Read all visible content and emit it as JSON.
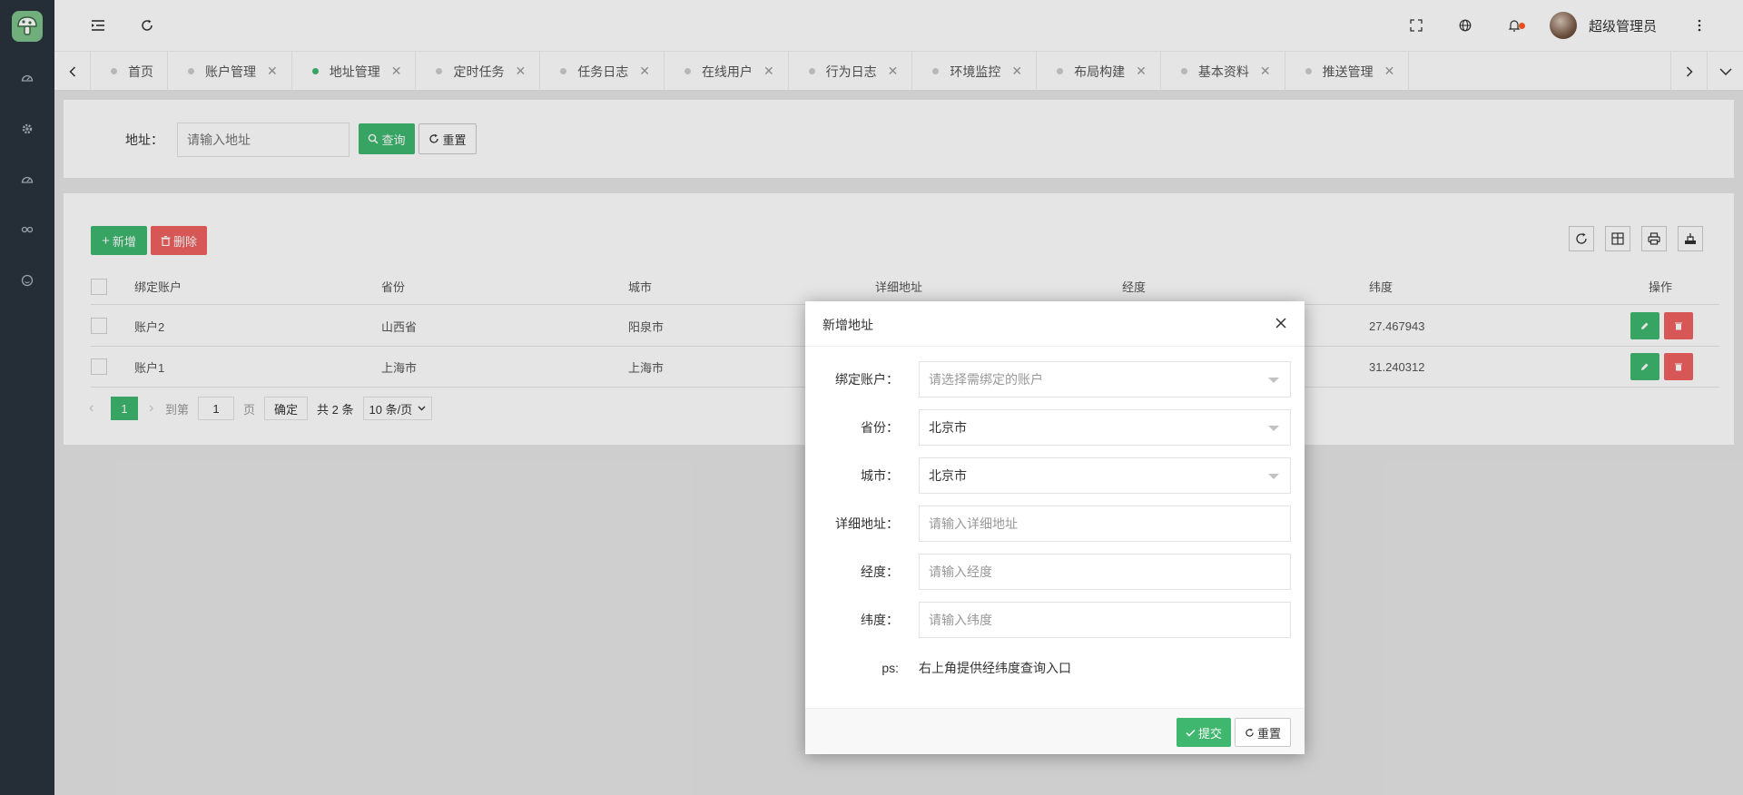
{
  "topbar": {
    "username": "超级管理员"
  },
  "tabs": [
    {
      "label": "首页",
      "closable": false,
      "active": false
    },
    {
      "label": "账户管理",
      "closable": true,
      "active": false
    },
    {
      "label": "地址管理",
      "closable": true,
      "active": true
    },
    {
      "label": "定时任务",
      "closable": true,
      "active": false
    },
    {
      "label": "任务日志",
      "closable": true,
      "active": false
    },
    {
      "label": "在线用户",
      "closable": true,
      "active": false
    },
    {
      "label": "行为日志",
      "closable": true,
      "active": false
    },
    {
      "label": "环境监控",
      "closable": true,
      "active": false
    },
    {
      "label": "布局构建",
      "closable": true,
      "active": false
    },
    {
      "label": "基本资料",
      "closable": true,
      "active": false
    },
    {
      "label": "推送管理",
      "closable": true,
      "active": false
    }
  ],
  "search": {
    "label": "地址：",
    "placeholder": "请输入地址",
    "query_btn": "查询",
    "reset_btn": "重置"
  },
  "toolbar": {
    "add_btn": "新增",
    "delete_btn": "删除"
  },
  "table": {
    "columns": [
      "绑定账户",
      "省份",
      "城市",
      "详细地址",
      "经度",
      "纬度",
      "操作"
    ],
    "rows": [
      {
        "account": "账户2",
        "province": "山西省",
        "city": "阳泉市",
        "address": "",
        "longitude": "",
        "latitude": "27.467943"
      },
      {
        "account": "账户1",
        "province": "上海市",
        "city": "上海市",
        "address": "",
        "longitude": "",
        "latitude": "31.240312"
      }
    ]
  },
  "pager": {
    "current": "1",
    "goto_label": "到第",
    "goto_value": "1",
    "page_label": "页",
    "confirm": "确定",
    "total": "共 2 条",
    "page_size": "10 条/页"
  },
  "modal": {
    "title": "新增地址",
    "fields": [
      {
        "label": "绑定账户：",
        "value": "",
        "placeholder": "请选择需绑定的账户",
        "type": "select"
      },
      {
        "label": "省份：",
        "value": "北京市",
        "placeholder": "",
        "type": "select"
      },
      {
        "label": "城市：",
        "value": "北京市",
        "placeholder": "",
        "type": "select"
      },
      {
        "label": "详细地址：",
        "value": "",
        "placeholder": "请输入详细地址",
        "type": "input"
      },
      {
        "label": "经度：",
        "value": "",
        "placeholder": "请输入经度",
        "type": "input"
      },
      {
        "label": "纬度：",
        "value": "",
        "placeholder": "请输入纬度",
        "type": "input"
      }
    ],
    "ps_label": "ps:",
    "ps_text": "右上角提供经纬度查询入口",
    "submit_btn": "提交",
    "reset_btn": "重置"
  },
  "colors": {
    "primary": "#3fb76f",
    "danger": "#f06060",
    "sidebar": "#2a343e"
  }
}
